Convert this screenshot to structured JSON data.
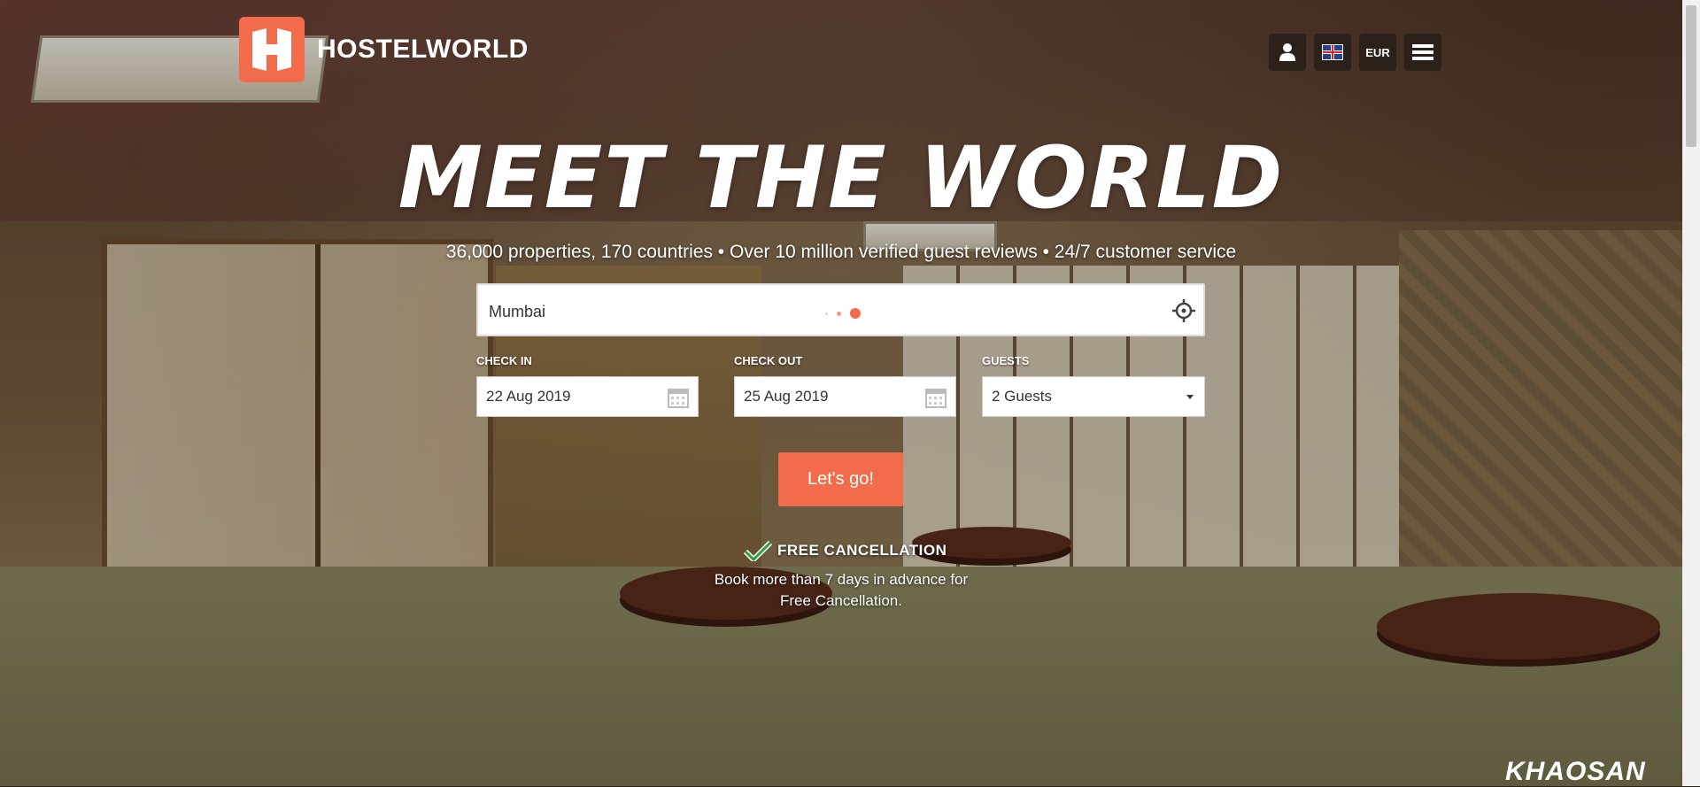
{
  "brand": {
    "name": "HOSTELWORLD",
    "color": "#f26b4a"
  },
  "nav": {
    "account_icon": "user-icon",
    "language_icon": "uk-flag-icon",
    "currency": "EUR",
    "menu_icon": "hamburger-menu-icon"
  },
  "hero": {
    "headline": "MEET THE WORLD",
    "tagline": "36,000 properties, 170 countries • Over 10 million verified guest reviews • 24/7 customer service",
    "watermark": "KHAOSAN"
  },
  "search": {
    "value": "Mumbai",
    "locate_icon": "crosshair-icon"
  },
  "check_in": {
    "label": "CHECK IN",
    "value": "22 Aug 2019"
  },
  "check_out": {
    "label": "CHECK OUT",
    "value": "25 Aug 2019"
  },
  "guests": {
    "label": "GUESTS",
    "value": "2 Guests"
  },
  "submit_label": "Let's go!",
  "free_cancellation": {
    "title": "FREE CANCELLATION",
    "line1": "Book more than 7 days in advance for",
    "line2": "Free Cancellation."
  }
}
